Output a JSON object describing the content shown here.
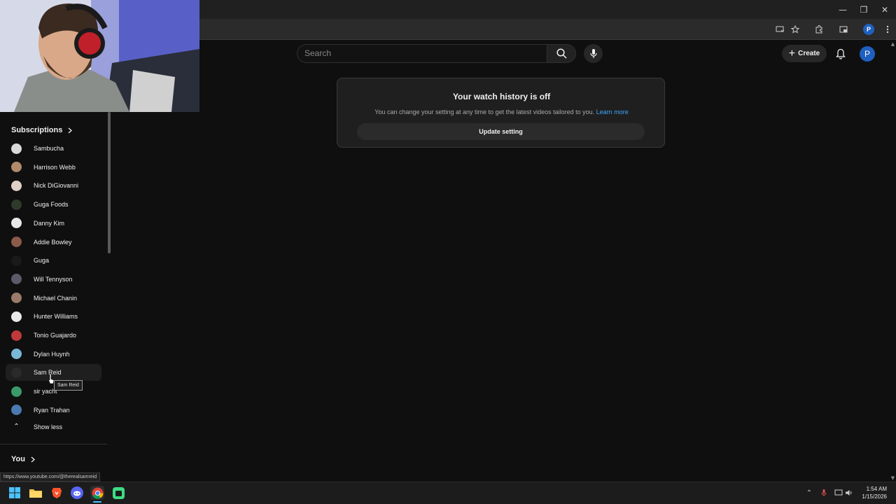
{
  "browser": {
    "window_controls": {
      "minimize": "—",
      "restore": "❐",
      "close": "✕"
    }
  },
  "masthead": {
    "search_placeholder": "Search",
    "create_label": "Create",
    "avatar_letter": "P",
    "profile_letter": "P"
  },
  "history_card": {
    "title": "Your watch history is off",
    "description": "You can change your setting at any time to get the latest videos tailored to you.",
    "learn_more": "Learn more",
    "update_button": "Update setting"
  },
  "sidebar": {
    "subscriptions_header": "Subscriptions",
    "subscriptions": [
      {
        "name": "Sambucha",
        "color": "#d9d9d9"
      },
      {
        "name": "Harrison Webb",
        "color": "#b08a6a"
      },
      {
        "name": "Nick DiGiovanni",
        "color": "#e0d0c8"
      },
      {
        "name": "Guga Foods",
        "color": "#2e3a2a"
      },
      {
        "name": "Danny Kim",
        "color": "#e8e8e8"
      },
      {
        "name": "Addie Bowley",
        "color": "#8a5a4a"
      },
      {
        "name": "Guga",
        "color": "#1a1a1a"
      },
      {
        "name": "Will Tennyson",
        "color": "#5a5a6a"
      },
      {
        "name": "Michael Chanin",
        "color": "#9a7a6a"
      },
      {
        "name": "Hunter Williams",
        "color": "#e8e8e8"
      },
      {
        "name": "Tonio Guajardo",
        "color": "#c0393b"
      },
      {
        "name": "Dylan Huynh",
        "color": "#7ab8d8"
      },
      {
        "name": "Sam Reid",
        "color": "#2a2a2a"
      },
      {
        "name": "sir yacht",
        "color": "#3a9a6a"
      },
      {
        "name": "Ryan Trahan",
        "color": "#4a7ab0"
      }
    ],
    "show_less": "Show less",
    "you_header": "You"
  },
  "tooltip": "Sam Reid",
  "status_url": "https://www.youtube.com/@therealsamreid",
  "taskbar": {
    "time": "1:54 AM",
    "date": "1/15/2026"
  }
}
